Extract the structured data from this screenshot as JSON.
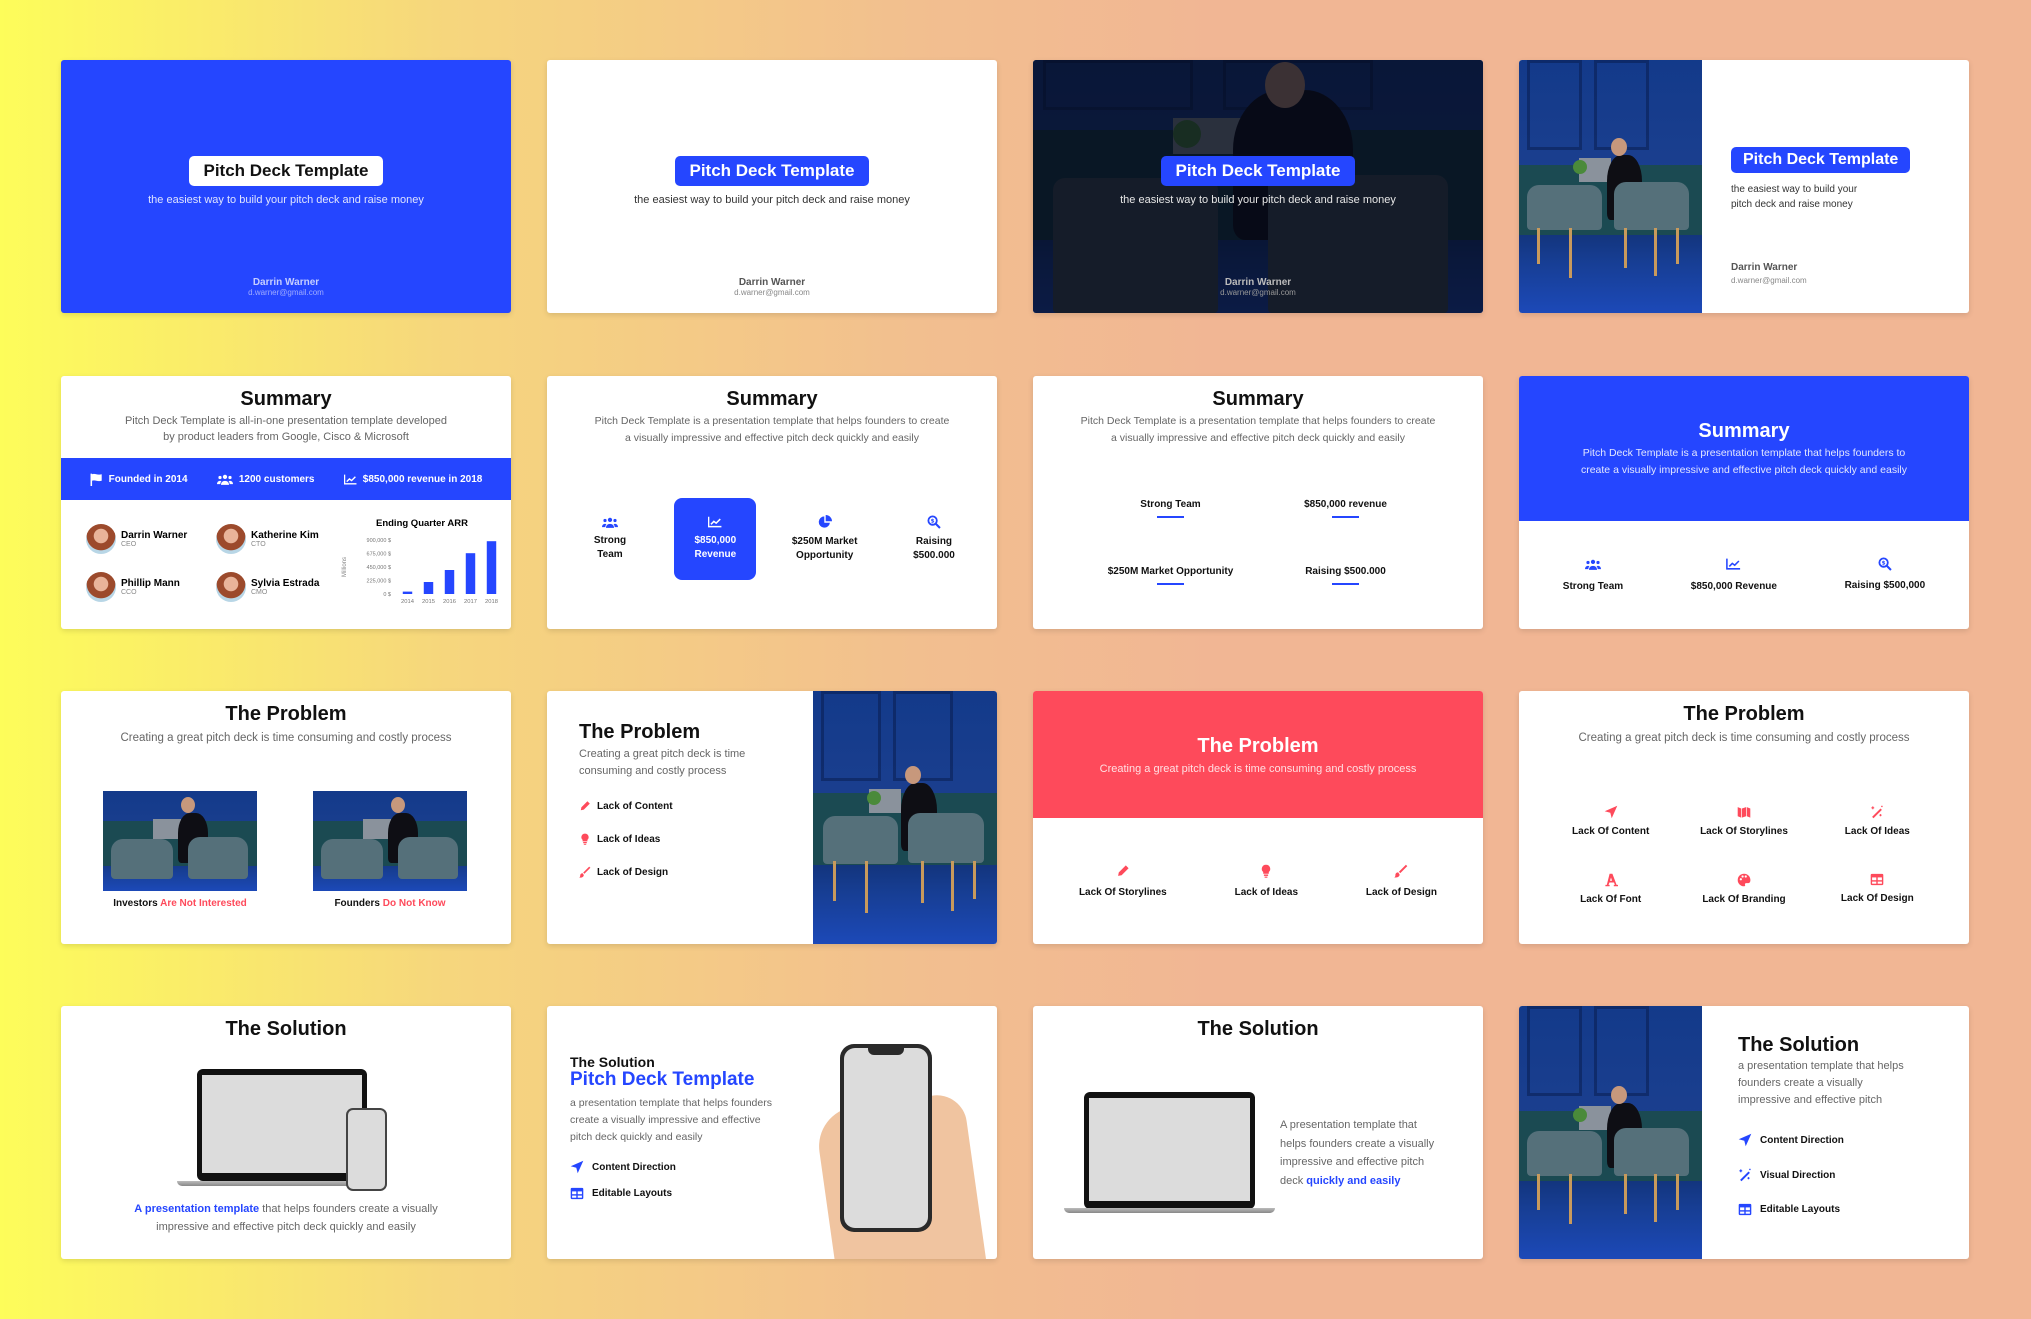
{
  "colors": {
    "brand_blue": "#2546ff",
    "accent_red": "#fe4a5b",
    "text_dark": "#111111",
    "text_muted": "#666666"
  },
  "title_slides": {
    "title": "Pitch Deck Template",
    "subtitle": "the easiest way to build your pitch deck and raise money",
    "subtitle_line1": "the easiest way to build your",
    "subtitle_line2": "pitch deck and raise money",
    "author_name": "Darrin Warner",
    "author_email": "d.warner@gmail.com"
  },
  "summary1": {
    "title": "Summary",
    "desc_line1": "Pitch Deck Template is all-in-one presentation template developed",
    "desc_line2": "by product leaders from Google, Cisco & Microsoft",
    "stats": [
      {
        "icon": "flag-icon",
        "label": "Founded in 2014"
      },
      {
        "icon": "users-icon",
        "label": "1200 customers"
      },
      {
        "icon": "chart-line-icon",
        "label": "$850,000 revenue in 2018"
      }
    ],
    "team": [
      {
        "name": "Darrin Warner",
        "role": "CEO"
      },
      {
        "name": "Katherine Kim",
        "role": "CTO"
      },
      {
        "name": "Phillip Mann",
        "role": "CCO"
      },
      {
        "name": "Sylvia Estrada",
        "role": "CMO"
      }
    ]
  },
  "chart_data": {
    "type": "bar",
    "title": "Ending Quarter ARR",
    "categories": [
      "2014",
      "2015",
      "2016",
      "2017",
      "2018"
    ],
    "values": [
      40000,
      200000,
      400000,
      680000,
      880000
    ],
    "ylabel": "Millions",
    "xlabel": "",
    "ylim": [
      0,
      900000
    ],
    "yticks": [
      "900,000 $",
      "675,000 $",
      "450,000 $",
      "225,000 $",
      "0 $"
    ],
    "grid": false,
    "color": "#2546ff"
  },
  "summary_common": {
    "title": "Summary",
    "desc_line1": "Pitch Deck Template is a presentation template that helps founders to create",
    "desc_line2": "a visually impressive and effective pitch deck quickly and easily",
    "desc4_line1": "Pitch Deck Template is a presentation template that helps founders to",
    "desc4_line2": "create a visually impressive and effective pitch deck quickly and easily"
  },
  "summary2": {
    "items": [
      {
        "icon": "users-icon",
        "line1": "Strong",
        "line2": "Team"
      },
      {
        "icon": "chart-line-icon",
        "line1": "$850,000",
        "line2": "Revenue",
        "highlighted": true
      },
      {
        "icon": "pie-chart-icon",
        "line1": "$250M Market",
        "line2": "Opportunity"
      },
      {
        "icon": "search-dollar-icon",
        "line1": "Raising",
        "line2": "$500.000"
      }
    ]
  },
  "summary3": {
    "items": [
      "Strong Team",
      "$850,000 revenue",
      "$250M Market Opportunity",
      "Raising $500.000"
    ]
  },
  "summary4": {
    "items": [
      {
        "icon": "users-icon",
        "label": "Strong Team"
      },
      {
        "icon": "chart-line-icon",
        "label": "$850,000 Revenue"
      },
      {
        "icon": "search-dollar-icon",
        "label": "Raising $500,000"
      }
    ]
  },
  "problem": {
    "title": "The Problem",
    "desc": "Creating a great pitch deck is time consuming and costly process",
    "desc_line1": "Creating a great pitch deck is time",
    "desc_line2": "consuming and costly process",
    "p1_captions": [
      {
        "lead": "Investors",
        "accent": "Are Not Interested"
      },
      {
        "lead": "Founders",
        "accent": "Do Not Know"
      }
    ],
    "p2_items": [
      {
        "icon": "pencil-icon",
        "label": "Lack of Content"
      },
      {
        "icon": "lightbulb-icon",
        "label": "Lack of Ideas"
      },
      {
        "icon": "paintbrush-icon",
        "label": "Lack of Design"
      }
    ],
    "p3_items": [
      {
        "icon": "pencil-icon",
        "label": "Lack Of Storylines"
      },
      {
        "icon": "lightbulb-icon",
        "label": "Lack of Ideas"
      },
      {
        "icon": "paintbrush-icon",
        "label": "Lack of Design"
      }
    ],
    "p4_items": [
      {
        "icon": "location-arrow-icon",
        "label": "Lack Of Content"
      },
      {
        "icon": "map-icon",
        "label": "Lack Of Storylines"
      },
      {
        "icon": "magic-wand-icon",
        "label": "Lack Of Ideas"
      },
      {
        "icon": "font-icon",
        "label": "Lack Of Font"
      },
      {
        "icon": "palette-icon",
        "label": "Lack Of Branding"
      },
      {
        "icon": "table-icon",
        "label": "Lack Of Design"
      }
    ]
  },
  "solution": {
    "title": "The Solution",
    "s1_accent": "A presentation template",
    "s1_rest": " that helps founders create a visually",
    "s1_line2": "impressive and effective pitch deck quickly and easily",
    "s2_brand": "Pitch Deck Template",
    "s2_desc_line1": "a presentation template that helps founders",
    "s2_desc_line2": "create a visually impressive and effective",
    "s2_desc_line3": "pitch deck quickly and easily",
    "s2_items": [
      {
        "icon": "location-arrow-icon",
        "label": "Content Direction"
      },
      {
        "icon": "table-icon",
        "label": "Editable Layouts"
      }
    ],
    "s3_line1": "A presentation template that",
    "s3_line2": "helps founders create a visually",
    "s3_line3": "impressive and effective pitch",
    "s3_line4_lead": "deck ",
    "s3_line4_accent": "quickly and easily",
    "s4_desc_line1": "a presentation template that helps",
    "s4_desc_line2": "founders create a visually",
    "s4_desc_line3": "impressive and effective pitch",
    "s4_items": [
      {
        "icon": "location-arrow-icon",
        "label": "Content Direction"
      },
      {
        "icon": "magic-wand-icon",
        "label": "Visual Direction"
      },
      {
        "icon": "table-icon",
        "label": "Editable Layouts"
      }
    ]
  }
}
